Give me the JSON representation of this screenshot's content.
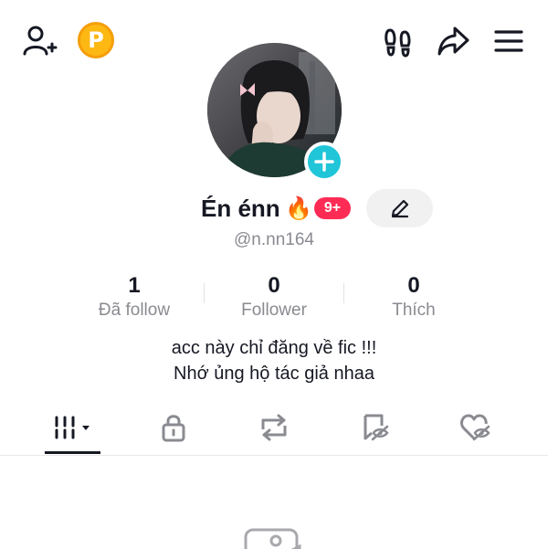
{
  "header": {
    "add_friend_icon": "person-plus-icon",
    "coin_label": "P",
    "footprint_icon": "footprints-icon",
    "share_icon": "share-arrow-icon",
    "menu_icon": "hamburger-menu-icon"
  },
  "profile": {
    "display_name": "Én énn",
    "fire_emoji": "🔥",
    "badge": "9+",
    "username": "@n.nn164",
    "edit_icon": "pencil-icon",
    "add_icon": "plus-icon"
  },
  "stats": [
    {
      "value": "1",
      "label": "Đã follow"
    },
    {
      "value": "0",
      "label": "Follower"
    },
    {
      "value": "0",
      "label": "Thích"
    }
  ],
  "bio": {
    "line1": "acc này chỉ đăng về fic !!!",
    "line2": "Nhớ ủng hộ tác giả nhaa"
  },
  "tabs": [
    {
      "name": "videos-grid-icon",
      "active": true
    },
    {
      "name": "lock-icon",
      "active": false
    },
    {
      "name": "repost-icon",
      "active": false
    },
    {
      "name": "favorites-icon",
      "active": false
    },
    {
      "name": "liked-icon",
      "active": false
    }
  ],
  "colors": {
    "accent": "#fe2c55",
    "avatar_plus": "#20c5d8",
    "coin": "#fdb813",
    "text_secondary": "#8a8b91"
  }
}
